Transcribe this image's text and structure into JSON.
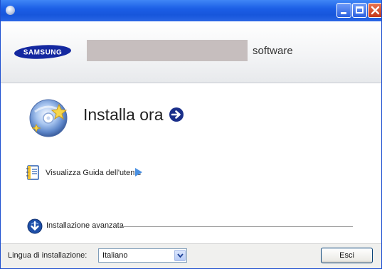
{
  "window": {
    "controls": {
      "minimize_icon": "minimize-icon",
      "maximize_icon": "maximize-icon",
      "close_icon": "close-icon"
    }
  },
  "header": {
    "logo_text": "SAMSUNG",
    "product_suffix": "software"
  },
  "main": {
    "install_now_label": "Installa ora",
    "user_guide_label": "Visualizza Guida dell'utente",
    "advanced_install_label": "Installazione avanzata"
  },
  "footer": {
    "language_label": "Lingua di installazione:",
    "language_selected": "Italiano",
    "exit_label": "Esci"
  },
  "colors": {
    "titlebar": "#1c5fe6",
    "samsung_blue": "#1428a0",
    "go_icon": "#1a2f8a",
    "play_icon": "#4a90e2"
  }
}
